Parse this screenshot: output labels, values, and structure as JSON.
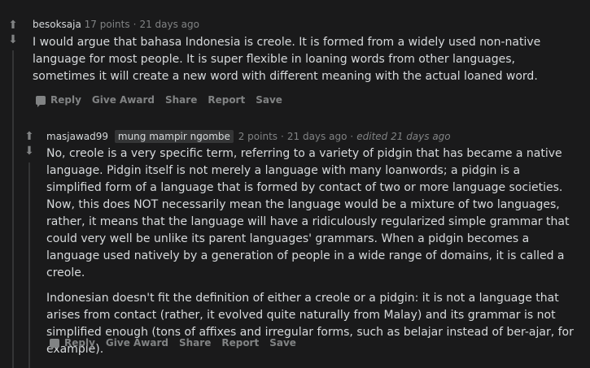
{
  "comment1": {
    "author": "besoksaja",
    "points": "17 points",
    "separator": "·",
    "time": "21 days ago",
    "body": "I would argue that bahasa Indonesia is creole. It is formed from a widely used non-native language for most people. It is super flexible in loaning words from other languages, sometimes it will create a new word with different meaning with the actual loaned word.",
    "actions": {
      "reply": "Reply",
      "give_award": "Give Award",
      "share": "Share",
      "report": "Report",
      "save": "Save"
    }
  },
  "comment2": {
    "author": "masjawad99",
    "flair": "mung mampir ngombe",
    "points": "2 points",
    "separator": "·",
    "time": "21 days ago",
    "edited": "edited 21 days ago",
    "paragraph1": "No, creole is a very specific term, referring to a variety of pidgin that has became a native language. Pidgin itself is not merely a language with many loanwords; a pidgin is a simplified form of a language that is formed by contact of two or more language societies. Now, this does NOT necessarily mean the language would be a mixture of two languages, rather, it means that the language will have a ridiculously regularized simple grammar that could very well be unlike its parent languages' grammars. When a pidgin becomes a language used natively by a generation of people in a wide range of domains, it is called a creole.",
    "paragraph2": "Indonesian doesn't fit the definition of either a creole or a pidgin: it is not a language that arises from contact (rather, it evolved quite naturally from Malay) and its grammar is not simplified enough (tons of affixes and irregular forms, such as belajar instead of ber-ajar, for example).",
    "actions": {
      "reply": "Reply",
      "give_award": "Give Award",
      "share": "Share",
      "report": "Report",
      "save": "Save"
    }
  },
  "icons": {
    "upvote": "upvote-arrow-icon",
    "downvote": "downvote-arrow-icon",
    "reply": "speech-bubble-icon"
  },
  "colors": {
    "background": "#1a1a1b",
    "text": "#d7dadc",
    "muted": "#818384",
    "flair_bg": "#343536"
  }
}
